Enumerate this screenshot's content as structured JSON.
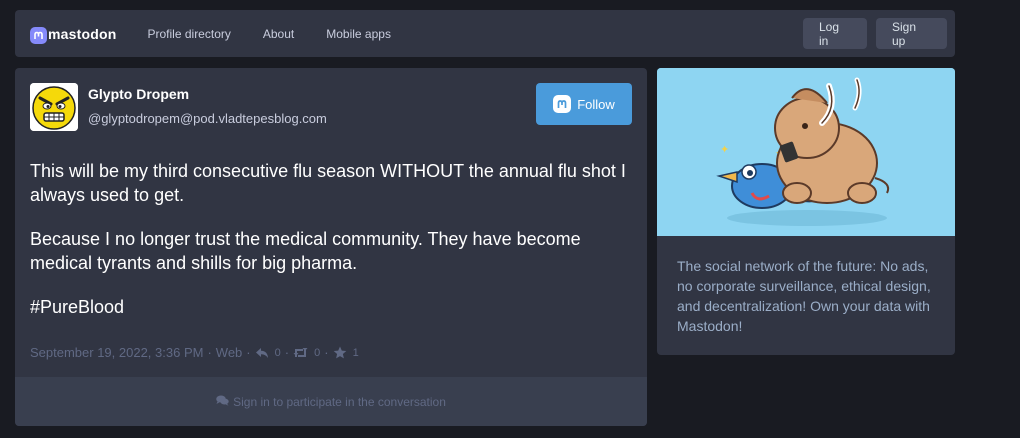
{
  "nav": {
    "logo_text": "mastodon",
    "links": [
      "Profile directory",
      "About",
      "Mobile apps"
    ],
    "login_label": "Log in",
    "signup_label": "Sign up"
  },
  "status": {
    "display_name": "Glypto Dropem",
    "username": "@glyptodropem@pod.vladtepesblog.com",
    "follow_label": "Follow",
    "paragraphs": [
      "This will be my third consecutive flu season WITHOUT the annual flu shot I always used to get.",
      "Because I no longer trust the medical community. They have become medical tyrants and shills for big pharma.",
      "#PureBlood"
    ],
    "timestamp": "September 19, 2022, 3:36 PM",
    "application": "Web",
    "reply_count": "0",
    "reblog_count": "0",
    "favourite_count": "1",
    "participate_text": "Sign in to participate in the conversation"
  },
  "hero": {
    "tagline": "The social network of the future: No ads, no corporate surveillance, ethical design, and decentralization! Own your data with Mastodon!"
  },
  "icons": {
    "logo": "mastodon-logo-icon",
    "follow": "mastodon-icon",
    "reply": "reply-icon",
    "reblog": "retweet-icon",
    "favourite": "star-icon",
    "comments": "comments-icon"
  },
  "colors": {
    "background": "#191b22",
    "panel": "#313543",
    "accent": "#4a9bdb",
    "muted": "#606984",
    "secondary_text": "#9baec8"
  }
}
